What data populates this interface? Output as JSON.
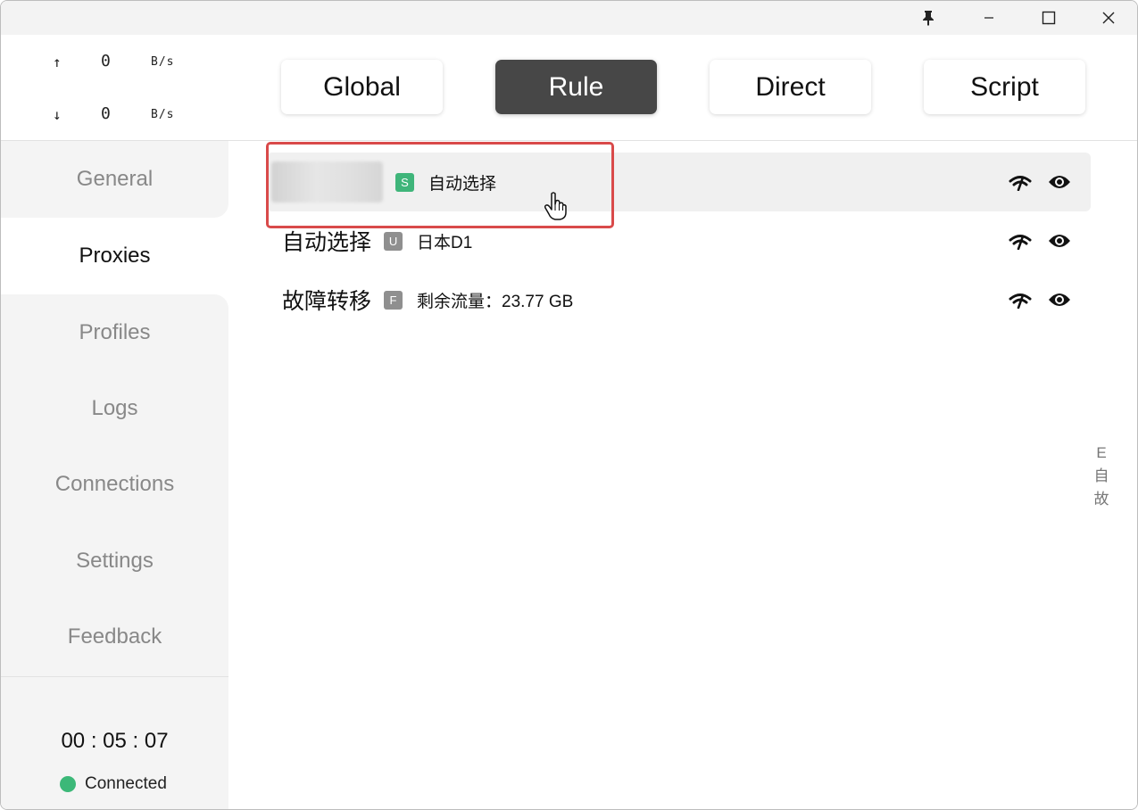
{
  "titlebar": {
    "pin_icon": "pin-icon",
    "minimize_icon": "minimize-icon",
    "maximize_icon": "maximize-icon",
    "close_icon": "close-icon"
  },
  "traffic": {
    "up": {
      "arrow": "↑",
      "value": "0",
      "unit": "B/s"
    },
    "down": {
      "arrow": "↓",
      "value": "0",
      "unit": "B/s"
    }
  },
  "nav": {
    "items": [
      {
        "label": "General"
      },
      {
        "label": "Proxies"
      },
      {
        "label": "Profiles"
      },
      {
        "label": "Logs"
      },
      {
        "label": "Connections"
      },
      {
        "label": "Settings"
      },
      {
        "label": "Feedback"
      }
    ],
    "active": "Proxies"
  },
  "footer": {
    "timer": "00 : 05 : 07",
    "status": "Connected",
    "status_color": "#3cb878"
  },
  "modes": {
    "items": [
      {
        "label": "Global"
      },
      {
        "label": "Rule"
      },
      {
        "label": "Direct"
      },
      {
        "label": "Script"
      }
    ],
    "active": "Rule"
  },
  "groups": [
    {
      "name": "",
      "badge": "S",
      "now": "自动选择",
      "name_blurred": true,
      "badge_color": "#3fb57a"
    },
    {
      "name": "自动选择",
      "badge": "U",
      "now": "日本D1",
      "badge_color": "#8f8f8f"
    },
    {
      "name": "故障转移",
      "badge": "F",
      "now": "剩余流量：23.77 GB",
      "badge_color": "#8f8f8f"
    }
  ],
  "side_index": [
    "E",
    "自",
    "故"
  ],
  "accent_highlight_color": "#d94a4a"
}
